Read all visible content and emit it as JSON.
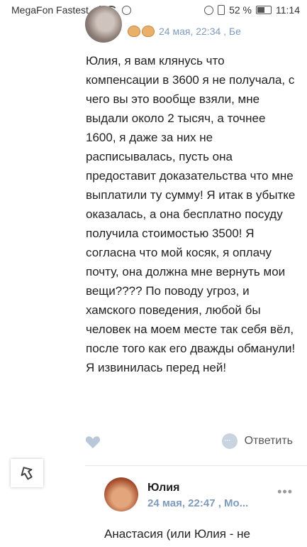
{
  "statusbar": {
    "carrier": "MegaFon Fastest",
    "battery": "52 %",
    "time": "11:14"
  },
  "comment1": {
    "meta": "24 мая, 22:34 , Бе",
    "text": "Юлия, я вам клянусь что компенсации в 3600 я не получала, с чего вы это вообще взяли, мне выдали около 2 тысяч, а точнее 1600, я даже за них не расписывалась, пусть она предоставит доказательства что мне выплатили ту сумму! Я итак в убытке оказалась, а она бесплатно посуду получила стоимостью 3500! Я согласна что мой косяк, я оплачу почту, она должна мне вернуть мои вещи???? По поводу угроз, и хамского поведения, любой бы человек на моем месте так себя вёл, после того как его дважды обманули! Я извинилась перед ней!",
    "reply_label": "Ответить"
  },
  "comment2": {
    "author": "Юлия",
    "meta": "24 мая, 22:47 , Мо...",
    "text": "Анастасия (или Юлия - не"
  },
  "colors": {
    "link_meta": "#7e9bbd",
    "like_icon": "#b9c8d8"
  }
}
